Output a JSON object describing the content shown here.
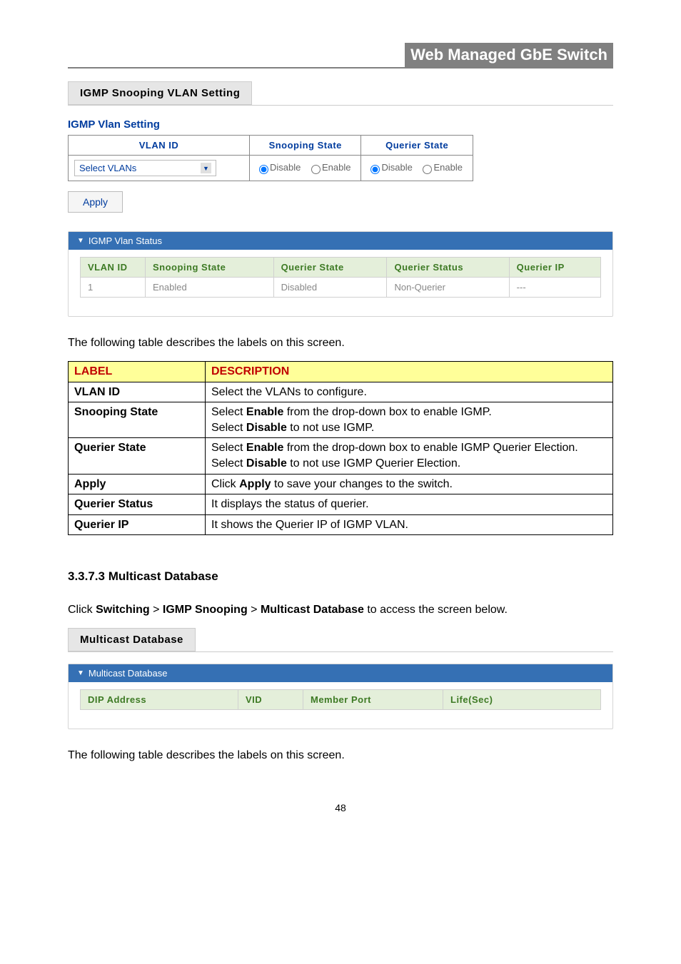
{
  "top_title": "Web Managed GbE Switch",
  "page_number": "48",
  "section1": {
    "header": "IGMP Snooping VLAN Setting",
    "panel_title": "IGMP Vlan Setting",
    "columns": {
      "vlan_id": "VLAN ID",
      "snooping_state": "Snooping State",
      "querier_state": "Querier State"
    },
    "vlan_select_label": "Select VLANs",
    "radio": {
      "disable": "Disable",
      "enable": "Enable"
    },
    "apply_label": "Apply",
    "status_header": "IGMP Vlan Status",
    "status_columns": {
      "vlan_id": "VLAN ID",
      "snooping_state": "Snooping State",
      "querier_state": "Querier State",
      "querier_status": "Querier Status",
      "querier_ip": "Querier IP"
    },
    "status_row": {
      "vlan_id": "1",
      "snooping_state": "Enabled",
      "querier_state": "Disabled",
      "querier_status": "Non-Querier",
      "querier_ip": "---"
    }
  },
  "intro_text": "The following table describes the labels on this screen.",
  "desc_table": {
    "h_label": "LABEL",
    "h_desc": "DESCRIPTION",
    "rows": [
      {
        "label": "VLAN ID",
        "desc_plain": "Select the VLANs to configure."
      },
      {
        "label": "Snooping State",
        "desc_html": "Select <strong>Enable</strong> from the drop-down box to enable IGMP.<br>Select <strong>Disable</strong> to not use IGMP."
      },
      {
        "label": "Querier State",
        "desc_html": "Select <strong>Enable</strong> from the drop-down box to enable IGMP Querier Election.<br>Select <strong>Disable</strong> to not use IGMP Querier Election."
      },
      {
        "label": "Apply",
        "desc_html": "Click <strong>Apply</strong> to save your changes to the switch."
      },
      {
        "label": "Querier Status",
        "desc_plain": "It displays the status of querier."
      },
      {
        "label": "Querier IP",
        "desc_plain": "It shows the Querier IP of IGMP VLAN."
      }
    ]
  },
  "section2": {
    "number_title": "3.3.7.3 Multicast Database",
    "breadcrumb": {
      "pre": "Click ",
      "a": "Switching",
      "sep": " > ",
      "b": "IGMP Snooping",
      "c": "Multicast Database",
      "post": " to access the screen below."
    },
    "header": "Multicast Database",
    "status_header": "Multicast Database",
    "columns": {
      "dip": "DIP Address",
      "vid": "VID",
      "member": "Member Port",
      "life": "Life(Sec)"
    }
  }
}
